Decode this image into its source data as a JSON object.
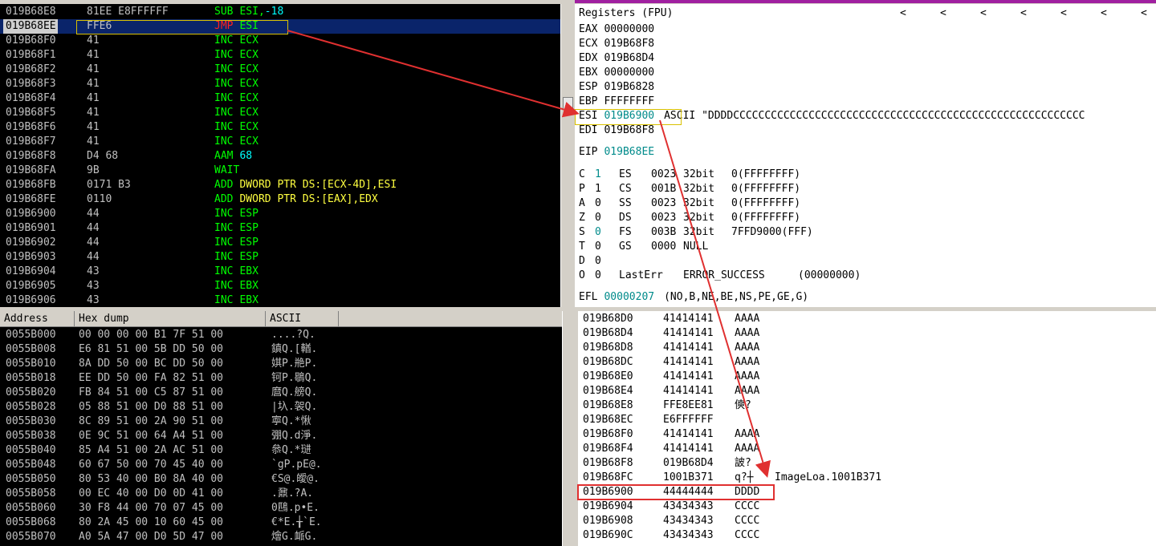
{
  "disassembly": {
    "rows": [
      {
        "addr": "019B68E8",
        "hex": "81EE E8FFFFFF",
        "mnem": "SUB",
        "args": "ESI,",
        "num": "-18",
        "mc": "green"
      },
      {
        "addr": "019B68EE",
        "hex": "FFE6",
        "mnem": "JMP",
        "args": "ESI",
        "num": "",
        "mc": "red",
        "selected": true
      },
      {
        "addr": "019B68F0",
        "hex": "41",
        "mnem": "INC",
        "args": "ECX",
        "num": "",
        "mc": "green"
      },
      {
        "addr": "019B68F1",
        "hex": "41",
        "mnem": "INC",
        "args": "ECX",
        "num": "",
        "mc": "green"
      },
      {
        "addr": "019B68F2",
        "hex": "41",
        "mnem": "INC",
        "args": "ECX",
        "num": "",
        "mc": "green"
      },
      {
        "addr": "019B68F3",
        "hex": "41",
        "mnem": "INC",
        "args": "ECX",
        "num": "",
        "mc": "green"
      },
      {
        "addr": "019B68F4",
        "hex": "41",
        "mnem": "INC",
        "args": "ECX",
        "num": "",
        "mc": "green"
      },
      {
        "addr": "019B68F5",
        "hex": "41",
        "mnem": "INC",
        "args": "ECX",
        "num": "",
        "mc": "green"
      },
      {
        "addr": "019B68F6",
        "hex": "41",
        "mnem": "INC",
        "args": "ECX",
        "num": "",
        "mc": "green"
      },
      {
        "addr": "019B68F7",
        "hex": "41",
        "mnem": "INC",
        "args": "ECX",
        "num": "",
        "mc": "green"
      },
      {
        "addr": "019B68F8",
        "hex": "D4 68",
        "mnem": "AAM",
        "args": "",
        "num": "68",
        "mc": "green"
      },
      {
        "addr": "019B68FA",
        "hex": "9B",
        "mnem": "WAIT",
        "args": "",
        "num": "",
        "mc": "green"
      },
      {
        "addr": "019B68FB",
        "hex": "0171 B3",
        "mnem": "ADD",
        "args": "DWORD PTR DS:[ECX-4D],ESI",
        "num": "",
        "mc": "green",
        "dword": true
      },
      {
        "addr": "019B68FE",
        "hex": "0110",
        "mnem": "ADD",
        "args": "DWORD PTR DS:[EAX],EDX",
        "num": "",
        "mc": "green",
        "dword": true
      },
      {
        "addr": "019B6900",
        "hex": "44",
        "mnem": "INC",
        "args": "ESP",
        "num": "",
        "mc": "green"
      },
      {
        "addr": "019B6901",
        "hex": "44",
        "mnem": "INC",
        "args": "ESP",
        "num": "",
        "mc": "green"
      },
      {
        "addr": "019B6902",
        "hex": "44",
        "mnem": "INC",
        "args": "ESP",
        "num": "",
        "mc": "green"
      },
      {
        "addr": "019B6903",
        "hex": "44",
        "mnem": "INC",
        "args": "ESP",
        "num": "",
        "mc": "green"
      },
      {
        "addr": "019B6904",
        "hex": "43",
        "mnem": "INC",
        "args": "EBX",
        "num": "",
        "mc": "green"
      },
      {
        "addr": "019B6905",
        "hex": "43",
        "mnem": "INC",
        "args": "EBX",
        "num": "",
        "mc": "green"
      },
      {
        "addr": "019B6906",
        "hex": "43",
        "mnem": "INC",
        "args": "EBX",
        "num": "",
        "mc": "green"
      }
    ]
  },
  "registers": {
    "title": "Registers (FPU)",
    "arrows": [
      "<",
      "<",
      "<",
      "<",
      "<",
      "<",
      "<"
    ],
    "gp": [
      {
        "name": "EAX",
        "value": "00000000"
      },
      {
        "name": "ECX",
        "value": "019B68F8"
      },
      {
        "name": "EDX",
        "value": "019B68D4"
      },
      {
        "name": "EBX",
        "value": "00000000"
      },
      {
        "name": "ESP",
        "value": "019B6828"
      },
      {
        "name": "EBP",
        "value": "FFFFFFFF"
      },
      {
        "name": "ESI",
        "value": "019B6900",
        "comment": "ASCII \"DDDDCCCCCCCCCCCCCCCCCCCCCCCCCCCCCCCCCCCCCCCCCCCCCCCCCCCCCCCC",
        "highlight": true
      },
      {
        "name": "EDI",
        "value": "019B68F8"
      }
    ],
    "eip": {
      "name": "EIP",
      "value": "019B68EE"
    },
    "flags": [
      {
        "f": "C",
        "v": "1",
        "vcyan": true,
        "seg": "ES",
        "sel": "0023",
        "bits": "32bit",
        "base": "0(FFFFFFFF)"
      },
      {
        "f": "P",
        "v": "1",
        "vcyan": false,
        "seg": "CS",
        "sel": "001B",
        "bits": "32bit",
        "base": "0(FFFFFFFF)"
      },
      {
        "f": "A",
        "v": "0",
        "vcyan": false,
        "seg": "SS",
        "sel": "0023",
        "bits": "32bit",
        "base": "0(FFFFFFFF)"
      },
      {
        "f": "Z",
        "v": "0",
        "vcyan": false,
        "seg": "DS",
        "sel": "0023",
        "bits": "32bit",
        "base": "0(FFFFFFFF)"
      },
      {
        "f": "S",
        "v": "0",
        "vcyan": true,
        "seg": "FS",
        "sel": "003B",
        "bits": "32bit",
        "base": "7FFD9000(FFF)"
      },
      {
        "f": "T",
        "v": "0",
        "vcyan": false,
        "seg": "GS",
        "sel": "0000",
        "bits": "NULL",
        "base": ""
      },
      {
        "f": "D",
        "v": "0",
        "vcyan": false,
        "seg": "",
        "sel": "",
        "bits": "",
        "base": ""
      },
      {
        "f": "O",
        "v": "0",
        "vcyan": false,
        "seg": "LastErr",
        "sel": "ERROR_SUCCESS",
        "bits": "(00000000)",
        "base": ""
      }
    ],
    "efl": {
      "name": "EFL",
      "value": "00000207",
      "comment": "(NO,B,NE,BE,NS,PE,GE,G)"
    }
  },
  "hexdump": {
    "headers": [
      "Address",
      "Hex dump",
      "ASCII"
    ],
    "rows": [
      {
        "addr": "0055B000",
        "hex": "00 00 00 00 B1 7F 51 00",
        "ascii": "....?Q."
      },
      {
        "addr": "0055B008",
        "hex": "E6 81 51 00 5B DD 50 00",
        "ascii": "鎮Q.[輶."
      },
      {
        "addr": "0055B010",
        "hex": "8A DD 50 00 BC DD 50 00",
        "ascii": "娸P.艵P."
      },
      {
        "addr": "0055B018",
        "hex": "EE DD 50 00 FA 82 51 00",
        "ascii": "钶P.鶡Q."
      },
      {
        "addr": "0055B020",
        "hex": "FB 84 51 00 C5 87 51 00",
        "ascii": "麿Q.艕Q."
      },
      {
        "addr": "0055B028",
        "hex": "05 88 51 00 D0 88 51 00",
        "ascii": "|圦.袈Q."
      },
      {
        "addr": "0055B030",
        "hex": "8C 89 51 00 2A 90 51 00",
        "ascii": "寕Q.*愀"
      },
      {
        "addr": "0055B038",
        "hex": "0E 9C 51 00 64 A4 51 00",
        "ascii": "弸Q.d淨."
      },
      {
        "addr": "0055B040",
        "hex": "85 A4 51 00 2A AC 51 00",
        "ascii": "叅Q.*琎"
      },
      {
        "addr": "0055B048",
        "hex": "60 67 50 00 70 45 40 00",
        "ascii": "`gP.pE@."
      },
      {
        "addr": "0055B050",
        "hex": "80 53 40 00 B0 8A 40 00",
        "ascii": "€S@.皧@."
      },
      {
        "addr": "0055B058",
        "hex": "00 EC 40 00 D0 0D 41 00",
        "ascii": ".鼐.?A."
      },
      {
        "addr": "0055B060",
        "hex": "30 F8 44 00 70 07 45 00",
        "ascii": "0鴄.p•E."
      },
      {
        "addr": "0055B068",
        "hex": "80 2A 45 00 10 60 45 00",
        "ascii": "€*E.╁`E."
      },
      {
        "addr": "0055B070",
        "hex": "A0 5A 47 00 D0 5D 47 00",
        "ascii": "燴G.衇G."
      }
    ]
  },
  "stack": {
    "rows": [
      {
        "addr": "019B68D0",
        "val": "41414141",
        "com": "AAAA",
        "extra": ""
      },
      {
        "addr": "019B68D4",
        "val": "41414141",
        "com": "AAAA",
        "extra": ""
      },
      {
        "addr": "019B68D8",
        "val": "41414141",
        "com": "AAAA",
        "extra": ""
      },
      {
        "addr": "019B68DC",
        "val": "41414141",
        "com": "AAAA",
        "extra": ""
      },
      {
        "addr": "019B68E0",
        "val": "41414141",
        "com": "AAAA",
        "extra": ""
      },
      {
        "addr": "019B68E4",
        "val": "41414141",
        "com": "AAAA",
        "extra": ""
      },
      {
        "addr": "019B68E8",
        "val": "FFE8EE81",
        "com": "傸?",
        "extra": ""
      },
      {
        "addr": "019B68EC",
        "val": "E6FFFFFF",
        "com": "",
        "extra": ""
      },
      {
        "addr": "019B68F0",
        "val": "41414141",
        "com": "AAAA",
        "extra": ""
      },
      {
        "addr": "019B68F4",
        "val": "41414141",
        "com": "AAAA",
        "extra": ""
      },
      {
        "addr": "019B68F8",
        "val": "019B68D4",
        "com": "詖?",
        "extra": ""
      },
      {
        "addr": "019B68FC",
        "val": "1001B371",
        "com": "q?┼",
        "extra": "ImageLoa.1001B371"
      },
      {
        "addr": "019B6900",
        "val": "44444444",
        "com": "DDDD",
        "extra": ""
      },
      {
        "addr": "019B6904",
        "val": "43434343",
        "com": "CCCC",
        "extra": ""
      },
      {
        "addr": "019B6908",
        "val": "43434343",
        "com": "CCCC",
        "extra": ""
      },
      {
        "addr": "019B690C",
        "val": "43434343",
        "com": "CCCC",
        "extra": ""
      }
    ]
  },
  "colors": {
    "annotation": "#e03030",
    "selection": "#0a246a"
  }
}
